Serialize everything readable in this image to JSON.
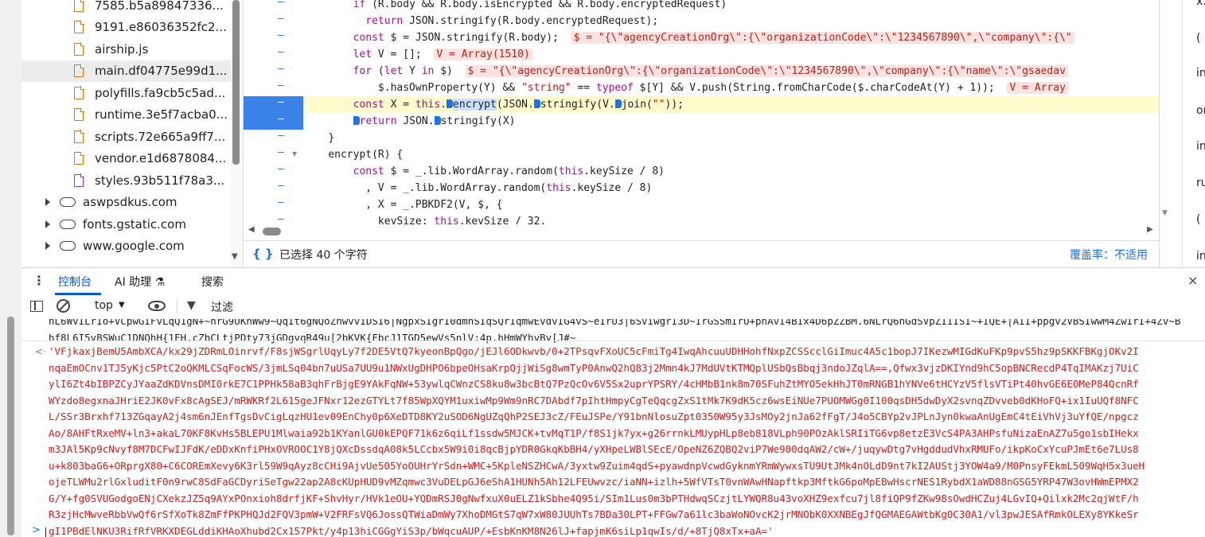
{
  "file_tree": {
    "files": [
      {
        "name": "7585.b5a89847336...",
        "type": "js"
      },
      {
        "name": "9191.e86036352fc2...",
        "type": "js"
      },
      {
        "name": "airship.js",
        "type": "js"
      },
      {
        "name": "main.df04775e99d1...",
        "type": "js",
        "selected": true
      },
      {
        "name": "polyfills.fa9cb5c5ad...",
        "type": "js"
      },
      {
        "name": "runtime.3e5f7acba0...",
        "type": "js"
      },
      {
        "name": "scripts.72e665a9ff7...",
        "type": "js"
      },
      {
        "name": "vendor.e1d6878084...",
        "type": "js"
      },
      {
        "name": "styles.93b511f78a3...",
        "type": "css"
      }
    ],
    "domains": [
      "aswpsdkus.com",
      "fonts.gstatic.com",
      "www.google.com"
    ]
  },
  "code_lines": [
    {
      "indent": "        ",
      "parts": [
        {
          "t": "if",
          "c": "kw"
        },
        {
          "t": " (R.body && R.body.isEncrypted && R.body.encryptedRequest)"
        }
      ]
    },
    {
      "indent": "          ",
      "parts": [
        {
          "t": "return",
          "c": "kw"
        },
        {
          "t": " JSON.stringify(R.body.encryptedRequest);"
        }
      ]
    },
    {
      "indent": "        ",
      "parts": [
        {
          "t": "const",
          "c": "kw"
        },
        {
          "t": " $ = JSON.stringify(R.body);  "
        },
        {
          "t": "$ = \"{\\\"agencyCreationOrg\\\":{\\\"organizationCode\\\":\\\"1234567890\\\",\\\"company\\\":{\\\"",
          "c": "inlinev"
        }
      ]
    },
    {
      "indent": "        ",
      "parts": [
        {
          "t": "let",
          "c": "kw"
        },
        {
          "t": " V = [];  "
        },
        {
          "t": "V = Array(1510)",
          "c": "inlinev"
        }
      ]
    },
    {
      "indent": "        ",
      "parts": [
        {
          "t": "for",
          "c": "kw"
        },
        {
          "t": " ("
        },
        {
          "t": "let",
          "c": "kw"
        },
        {
          "t": " Y "
        },
        {
          "t": "in",
          "c": "kw"
        },
        {
          "t": " $)  "
        },
        {
          "t": "$ = \"{\\\"agencyCreationOrg\\\":{\\\"organizationCode\\\":\\\"1234567890\\\",\\\"company\\\":{\\\"name\\\":\\\"gsaedav",
          "c": "inlinev"
        }
      ]
    },
    {
      "indent": "            ",
      "parts": [
        {
          "t": "$.hasOwnProperty(Y) && "
        },
        {
          "t": "\"string\"",
          "c": "str"
        },
        {
          "t": " == "
        },
        {
          "t": "typeof",
          "c": "kw"
        },
        {
          "t": " $[Y] && V.push(String.fromCharCode($.charCodeAt(Y) + 1));  "
        },
        {
          "t": "V = Array",
          "c": "inlinev"
        }
      ]
    },
    {
      "indent": "        ",
      "paused": true,
      "parts": [
        {
          "t": "const",
          "c": "kw"
        },
        {
          "t": " X = "
        },
        {
          "t": "this",
          "c": "kw"
        },
        {
          "t": "."
        },
        {
          "t": "M",
          "c": "mark"
        },
        {
          "t": "encrypt",
          "c": "selword"
        },
        {
          "t": "(JSON."
        },
        {
          "t": "M",
          "c": "mark"
        },
        {
          "t": "stringify(V."
        },
        {
          "t": "M",
          "c": "mark"
        },
        {
          "t": "join("
        },
        {
          "t": "\"\"",
          "c": "str"
        },
        {
          "t": "));"
        }
      ]
    },
    {
      "indent": "        ",
      "parts": [
        {
          "t": "M",
          "c": "mark"
        },
        {
          "t": "return",
          "c": "kw"
        },
        {
          "t": " JSON."
        },
        {
          "t": "M",
          "c": "mark"
        },
        {
          "t": "stringify(X)"
        }
      ]
    },
    {
      "indent": "    ",
      "parts": [
        {
          "t": "}"
        }
      ]
    },
    {
      "indent": "    ",
      "parts": [
        {
          "t": "encrypt(R) {"
        }
      ]
    },
    {
      "indent": "        ",
      "parts": [
        {
          "t": "const",
          "c": "kw"
        },
        {
          "t": " $ = _.lib.WordArray.random("
        },
        {
          "t": "this",
          "c": "kw"
        },
        {
          "t": ".keySize / 8)"
        }
      ]
    },
    {
      "indent": "          ",
      "parts": [
        {
          "t": ", V = _.lib.WordArray.random("
        },
        {
          "t": "this",
          "c": "kw"
        },
        {
          "t": ".keySize / 8)"
        }
      ]
    },
    {
      "indent": "          ",
      "parts": [
        {
          "t": ", X = _.PBKDF2(V, $, {"
        }
      ]
    },
    {
      "indent": "            ",
      "parts": [
        {
          "t": "keySize: "
        },
        {
          "t": "this",
          "c": "kw"
        },
        {
          "t": ".keySize / 32,"
        }
      ]
    }
  ],
  "code_status": {
    "brace_icon": "{ }",
    "selection_text": "已选择 40 个字符",
    "coverage_text": "覆盖率：不适用"
  },
  "right_panel": [
    "x.",
    "(",
    "in",
    "or",
    "in",
    "ru",
    "(",
    "in"
  ],
  "drawer": {
    "tabs": [
      {
        "label": "控制台",
        "active": true
      },
      {
        "label": "AI 助理 ⚗",
        "active": false
      },
      {
        "label": "搜索",
        "active": false
      }
    ],
    "close_glyph": "×"
  },
  "console_toolbar": {
    "context": "top",
    "filter_label": "过滤"
  },
  "console": {
    "previous_lines": [
      "nL6WvILrIo+VCpwGIFvLqQ1gN+~nrG9UKnWw9~QqIt6gNQoZnwvvIDSI6|NgpxSIgrI0dmnSIqSQrIqmwEvdvIG4vS~eIrU3|6SvIwgrI3D~IrGSSmIrU+pnAvI4BIx4D6pZZBM.6NLrQ6nGdSVpZIIISI~+IQE+|AII+ppgv2VBSIwwM4ZwIrI+4Zv~B",
      "hf8L6I5vBSWuC1DNQhH{1FH.cZbCLtjPDty73jGDgvqR49u[2bKVK{FbcJ1TGD5ewVs5nlV:4p.hHmWYhvBv[J#~"
    ],
    "result_lines": [
      "'VFjkaxjBemU5AmbXCA/kx29jZDRmLOinrvf/F8sjWSgrlUqyLy7f2DE5VtQ7kyeonBpQgo/jEJl6ODkwvb/0+2TPsqvFXoUC5cFmiTg4IwqAhcuuUDHHohfNxpZCSScclGiImuc4A5c1bopJ7IKezwMIGdKuFKp9pvS5hz9pSKKFBKgjOKv2I",
      "nqaEmOCnv1TJ5yKjc5PtC2oQKMLCSqFocWS/3jmLSq04bn7uUSa7UU9u1NWxUgDHPO6bpeOHsaKrpQjjWiSg8wmTyP0AnwQ2hQ83j2Mmn4kJ7MdUVtKTMQplUSbQsBbqj3ndoJZqlA==,Qfwx3vjzDKIYnd9hC5opBNCRecdP4TqIMAKzj7UiC",
      "ylI6Zt4bIBPZCyJYaaZdKDVnsDMI0rkE7C1PPHk58aB3qhFrBjgE9YAkFqNW+53ywlqCWnzCS8ku8w3bcBtQ7PzQcOv6V5Sx2uprYPSRY/4cHMbB1nk8m70SFuhZtMYO5ekHhJT0mRNGB1hYNVe6tHCYzV5flsVTiPt40hvGE6E0MeP84QcnRf",
      "WYzdo8egxnaJHriE2JK0vFx8cAgSEJ/mRWKRf2L615geJFNxr12ezGTYLt7f85WpXQYM1uxiwMp9Wm9nRC7DAbdf7pIhtHmpyCgTeQqcgZxS1tMk7K9dK5cz6wsEiNUe7PUOMWGg0I100qsDH5dwDyX2svnqZDvveb0dKHoFQ+ix1IuUQf8NFC",
      "L/SSr3Brxhf713ZGqayA2j4sm6nJEnfTgsDvCigLqzHU1ev09EnChy0p6XeDTD8KY2uSOD6NgUZqQhP2SEJ3cZ/FEuJSPe/Y91bnNlosuZpt0350W95y3JsMOy2jnJa62fFgT/J4o5CBYp2vJPLnJyn0kwaAnUgEmC4tEiVhVj3uYfQE/npgcz",
      "Ao/8AHFtRxeMV+ln3+akaL70KF8KvHs5BLEPU1Mlwaia92b1KYanlGU0kEPQF71k6z6qiLf1ssdw5MJCK+tvMqT1P/f8S1jk7yx+g26rrnkLMUypHLp8eb818VLph90POzAklSRIiTG6vp8etzE3VcS4PA3AHPsfuNizaEnAZ7u5go1sbIHekx",
      "m3JAl5Kp9cNvyf8M7DCFwIJFdK/eDDxKnfiPHxOVROOC1Y8jQXcDssdqA08k5LCcbx5W9i0i8qcBjpYDR0GkqKbBH4/yXHpeLWBlSEcE/OpeNZ6ZQBQ2viP7We900dqAW2/cW+/juqywDtg7vHgddudVhxRMUFo/ikpKoCxYcuPJmEt6e7LUs8",
      "u+k803baG6+ORprgX80+C6COREmXevy6K3rl59W9qAyz8cCHi9AjvUe505YoOUHrYrSdn+WMC+5KpleNSZHCwA/3yxtw9Zuim4qdS+pyawdnpVcwdGyknmYRmWywxsTU9UtJMk4nOLdD9nt7kI2AUStj3YOW4a9/M0PnsyFEkmL509WqH5x3ueH",
      "ojeTLWMu2rlGxluditF0n9rwC8SdFaGCDyriSeTgw22ap2A8cKUpHUD9vMZqmwc3VuDELpGJ6eShA1HUNh5Ah12LFEUwvzc/iaNN+izlh+5WfVTsT0vnWAwHNapftkp3MftkG6poMpEBwHscrNES1RybdX1aWD88nGSG5YRP47W3ovHWmEPMX2",
      "G/Y+fg0SVUGodgoENjCXekzJZ5q9AYxPOnxioh8drfjKF+ShvHyr/HVk1eOU+YQDmRSJ0gNwfxuX0uELZ1kSbhe4Q95i/SIm1Lus0m3bPTHdwqSCzjtLYWQR8u43voXHZ9exfcu7jl8fiQP9fZKw98sOwdHCZuj4LGvIQ+Qilxk2Mc2qjWtF/h",
      "R3zjHcMwveRbbVwQf6rSfXoTk8ZmFfPKPHQJd2FQV3pmW+V2FRFsVQ6JossQTWiaDmWy7XhoDMGtS7qW7xW80JUUhTs7BDa30LPT+FFGw7a61lc3baWoNOvcK2jrMNObK0XXNBEgJfQGMAEGAWtbKg0C30A1/vl3pwJESAfRmkOLEXy8YKkeSr",
      "gI1PBdElNKU3RifRfVRKXDEGLddiKHAoXhubd2Cx157Pkt/y4p13hiCGGgYiS3p/bWqcuAUP/+EsbKnKM8N26lJ+fapjmK6siLp1qwIs/d/+8TjQ8xTx+aA='"
    ]
  }
}
